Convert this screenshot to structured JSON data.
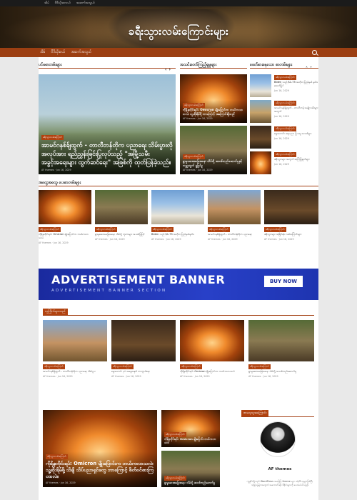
{
  "topbar": {
    "links": [
      "အိမ်",
      "ဗီဒီယိုအလယ်",
      "အဆက်အသွယ်"
    ]
  },
  "site": {
    "title": "ခရီးသွားလမ်းကြောင်းများ"
  },
  "nav": {
    "items": [
      "အိမ်",
      "ဗီဒီယိုဆယ်",
      "အဆက်အသွယ်"
    ]
  },
  "sections": {
    "featured": "ပင်မစာတမ်းများ",
    "popular": "အသင်းတော်ကြည့်ရှုမှုများ",
    "latest": "ခေတ်စားနေသော စာတမ်းများ",
    "all": "အထွေအထွေ ပေးစာတမ်းများ",
    "trending": "လူကြိုက်များသည်",
    "author": "စာရေးသူအကြောင်း"
  },
  "featured": {
    "badge": "ခရီးသွားလမ်းကြောင်း",
    "headline": "အာမင်ဂနစ်ခ်ျထွက် - တာလီဘန်တိုက ပညာရေး သိမ်းပွားလို အလုပ်အား ရည်ညွှန်းခြင်းပြုလုပ်သည့် \"အမြို့သမီး အခွင့်အရေးများ ထွက်ဆင်ရေး\" အဖြစ်ကို ထုတ်ပြန်ခဲ့သည်။",
    "author": "AF themes",
    "date": "Jun 16, 2029"
  },
  "popular": [
    {
      "badge": "ခရီးသွားလမ်းကြောင်း",
      "title": "ကိုရိုနာဗိုင်းရပ်: Omicron မျိုးပြောင်းက ဘယ်ကလာသလဲ၊ သူ့ဆိုးရိမ်ဖို့ ဘာကြောင့် အကြောင်းရှိသည်",
      "author": "AF themes",
      "date": "Jun 16, 2029"
    },
    {
      "badge": "ခရီးသွားလမ်းကြောင်း",
      "title": "ရွာမှုဆေးအခြေအနေ: သိမ်းပို့ အသစ်တည်ဆောက်မှုနှင့် ကမ္ဘာ့တွက် ရှုမြင်မှု",
      "author": "AF themes",
      "date": "Jun 16, 2029"
    }
  ],
  "latest": [
    {
      "badge": "ခရီးသွားလမ်းကြောင်း",
      "title": "Biden သည် $1.75 အတိုးဝ ပြည်နယ် မူဝါဒ အောင်မြင်",
      "date": "Jun 16, 2029"
    },
    {
      "badge": "ခရီးသွားလမ်းကြောင်း",
      "title": "အာမင်ဂနစ်ခ်ျထွက် - တာလီဘန် အမျိုးသမီးများ အတွက်",
      "date": "Jun 16, 2029"
    },
    {
      "badge": "ခရီးသွားလမ်းကြောင်း",
      "title": "ရှေးဟောင်း အနုပညာ ပြသမှု အသစ်များ",
      "date": "Jun 16, 2029"
    },
    {
      "badge": "ခရီးသွားလမ်းကြောင်း",
      "title": "ခရီးသွားများ အတွက် အကြံပြုချက်များ",
      "date": "Jun 16, 2029"
    }
  ],
  "grid": [
    {
      "badge": "ခရီးသွားလမ်းကြောင်း",
      "title": "ကိုရိုနာဗိုင်းရပ်: Omicron မျိုးပြောင်းက ဘယ်ကလာသလဲ",
      "author": "AF themes",
      "date": "Jun 16, 2029"
    },
    {
      "badge": "ခရီးသွားလမ်းကြောင်း",
      "title": "ရွာမှုဆေးအခြေအနေ: သိမ်းပို့ ဘူတာများ အသစ်ပြုပြင်",
      "author": "AF themes",
      "date": "Jun 16, 2029"
    },
    {
      "badge": "ခရီးသွားလမ်းကြောင်း",
      "title": "Biden သည် $1.75 အတိုးဝ ပြည်နယ်မူဝါဒ",
      "author": "AF themes",
      "date": "Jun 16, 2029"
    },
    {
      "badge": "ခရီးသွားလမ်းကြောင်း",
      "title": "အာမင်ဂနစ်ခ်ျထွက် - တာလီဘန်တိုက ပညာရေး",
      "author": "AF themes",
      "date": "Jun 16, 2029"
    },
    {
      "badge": "ခရီးသွားလမ်းကြောင်း",
      "title": "ခရီးသွားများ အမြိုင်ဆုံး လမ်းကြောင်းများ",
      "author": "AF themes",
      "date": "Jun 16, 2029"
    }
  ],
  "ad": {
    "title": "ADVERTISEMENT BANNER",
    "subtitle": "ADVERTISEMENT BANNER SECTION",
    "button": "BUY NOW"
  },
  "trending": [
    {
      "badge": "ခရီးသွားလမ်းကြောင်း",
      "title": "အာမင်ဂနစ်ခ်ျထွက် - တာလီဘန်တိုက ပညာရေး သိမ်းပွား",
      "author": "AF themes",
      "date": "Jun 16, 2029"
    },
    {
      "badge": "ခရီးသွားလမ်းကြောင်း",
      "title": "ရှေးဟောင်း ပုဂံ အမွေအနှစ် ကာကွယ်ရေး",
      "author": "AF themes",
      "date": "Jun 16, 2029"
    },
    {
      "badge": "ခရီးသွားလမ်းကြောင်း",
      "title": "ကိုရိုနာဗိုင်းရပ်: Omicron မျိုးပြောင်းက ဘယ်ကလာသလဲ",
      "author": "AF themes",
      "date": "Jun 16, 2029"
    },
    {
      "badge": "ခရီးသွားလမ်းကြောင်း",
      "title": "ရွာမှုဆေးအခြေအနေ: သိမ်းပို့ အသစ်တည်ဆောက်မှု",
      "author": "AF themes",
      "date": "Jun 16, 2029"
    }
  ],
  "big": {
    "badge": "ခရီးသွားလမ်းကြောင်း",
    "title": "ကိုရိုနာဗိုင်းရပ်: Omicron မျိုးပြောင်းက ဘယ်ကလာသလဲ၊ သူ့ဆိုးရိမ်ဖို့ သိချိ သိပ်ပညာရှင်တွေ ဘာကြောင့် စိတ်ဝင်စားကြတာလဲ။",
    "author": "AF themes",
    "date": "Jun 16, 2029"
  },
  "side_small": [
    {
      "badge": "ခရီးသွားလမ်းကြောင်း",
      "title": "ကိုရိုနာဗိုင်းရပ်: Omicron မျိုးပြောင်း ဘယ်ကလာသလဲ"
    },
    {
      "badge": "ခရီးသွားလမ်းကြောင်း",
      "title": "ရွာမှုဆေးအခြေအနေ: သိမ်းပို့ အသစ်တည်ဆောက်မှု"
    }
  ],
  "author": {
    "name": "AF themes",
    "bio": "ကျွန်ုပ်တို့သည် WordPress အခြေပြ theme များ ဖန်တီးသူများဖြစ်ပြီး သုံးစွဲသူများအတွက် အကောင်းဆုံး ဒီဇိုင်းများကို ပေးအပ်ပါသည်။"
  }
}
